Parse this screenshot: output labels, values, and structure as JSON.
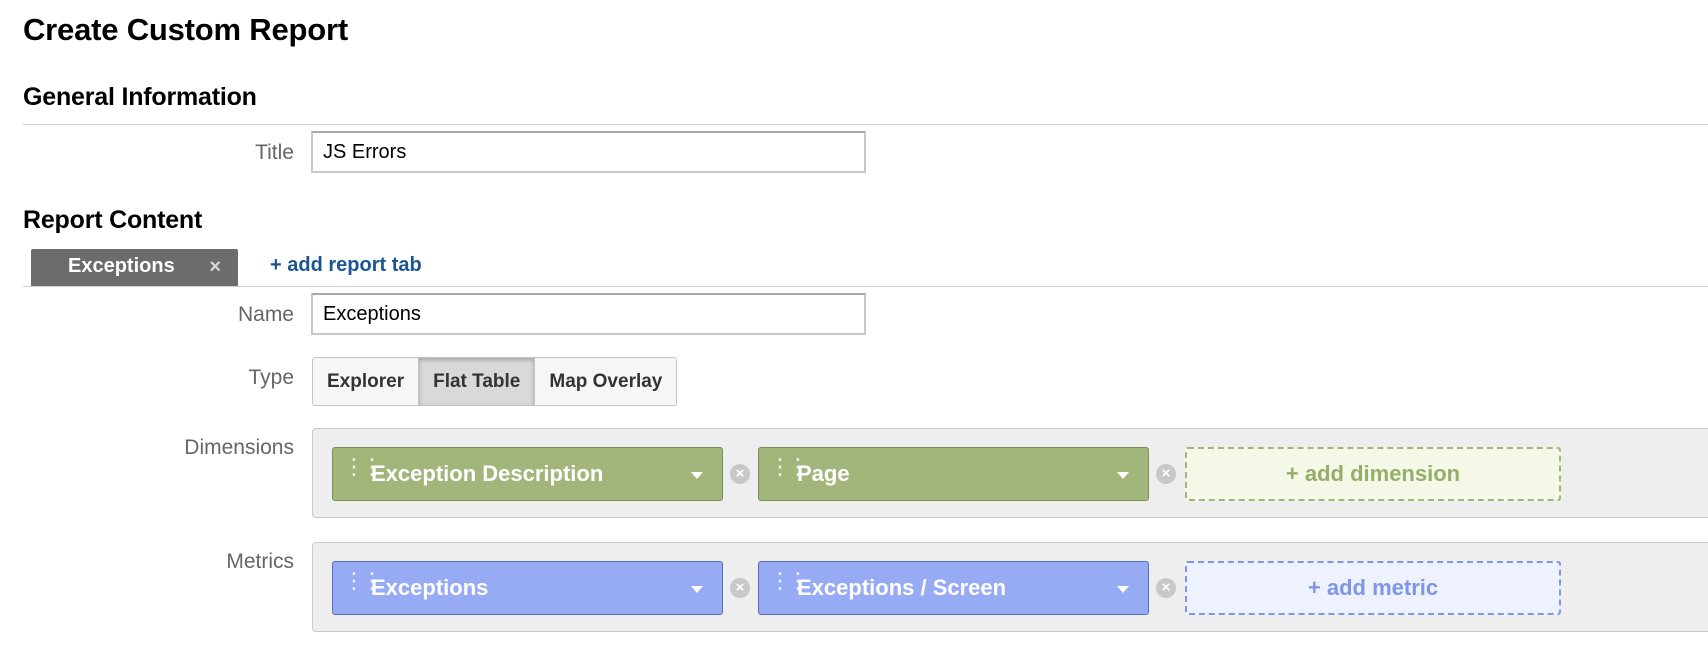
{
  "page": {
    "title": "Create Custom Report"
  },
  "general": {
    "heading": "General Information",
    "title_label": "Title",
    "title_value": "JS Errors"
  },
  "content": {
    "heading": "Report Content",
    "tabs": [
      {
        "label": "Exceptions",
        "close": "×"
      }
    ],
    "add_tab_label": "+ add report tab",
    "name_label": "Name",
    "name_value": "Exceptions",
    "type_label": "Type",
    "types": [
      {
        "label": "Explorer",
        "active": false
      },
      {
        "label": "Flat Table",
        "active": true
      },
      {
        "label": "Map Overlay",
        "active": false
      }
    ],
    "dimensions_label": "Dimensions",
    "dimensions": [
      {
        "label": "Exception Description"
      },
      {
        "label": "Page"
      }
    ],
    "add_dimension_label": "+ add dimension",
    "metrics_label": "Metrics",
    "metrics": [
      {
        "label": "Exceptions"
      },
      {
        "label": "Exceptions / Screen"
      }
    ],
    "add_metric_label": "+ add metric"
  },
  "colors": {
    "dimension_pill": "#a2b67c",
    "metric_pill": "#97abf4",
    "link": "#1c5691",
    "tab": "#6c6c6c"
  },
  "icons": {
    "grip": "drag-handle-icon",
    "caret": "chevron-down-icon",
    "remove": "remove-circle-icon",
    "tab_close": "close-icon"
  }
}
